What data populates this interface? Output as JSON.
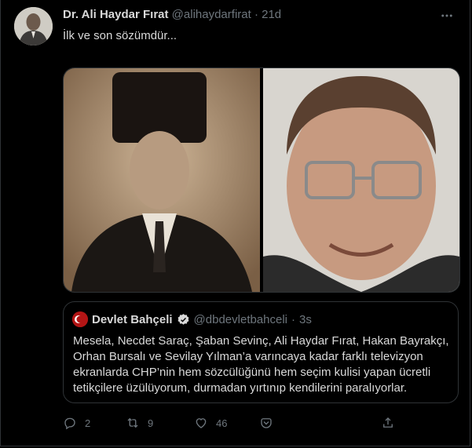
{
  "tweet": {
    "author_name": "Dr. Ali Haydar Fırat",
    "handle": "@alihaydarfirat",
    "separator": "·",
    "time": "21d",
    "text": "İlk ve son sözümdür..."
  },
  "quote": {
    "author_name": "Devlet Bahçeli",
    "handle": "@dbdevletbahceli",
    "separator": "·",
    "time": "3s",
    "text": "Mesela, Necdet Saraç, Şaban Sevinç, Ali Haydar Fırat, Hakan Bayrakçı, Orhan Bursalı ve Sevilay Yılman’a varıncaya kadar farklı televizyon ekranlarda CHP’nin hem sözcülüğünü hem seçim kulisi yapan ücretli tetikçilere üzülüyorum, durmadan yırtınıp kendilerini paralıyorlar."
  },
  "actions": {
    "reply_count": "2",
    "retweet_count": "9",
    "like_count": "46"
  },
  "colors": {
    "background": "#000000",
    "text": "#d9d9d9",
    "muted": "#6e767d",
    "border": "#2f3336",
    "verified": "#d9d9d9"
  },
  "icons": {
    "more": "more-icon",
    "verified": "verified-icon",
    "reply": "reply-icon",
    "retweet": "retweet-icon",
    "like": "like-icon",
    "bookmark": "bookmark-icon",
    "share": "share-icon"
  }
}
